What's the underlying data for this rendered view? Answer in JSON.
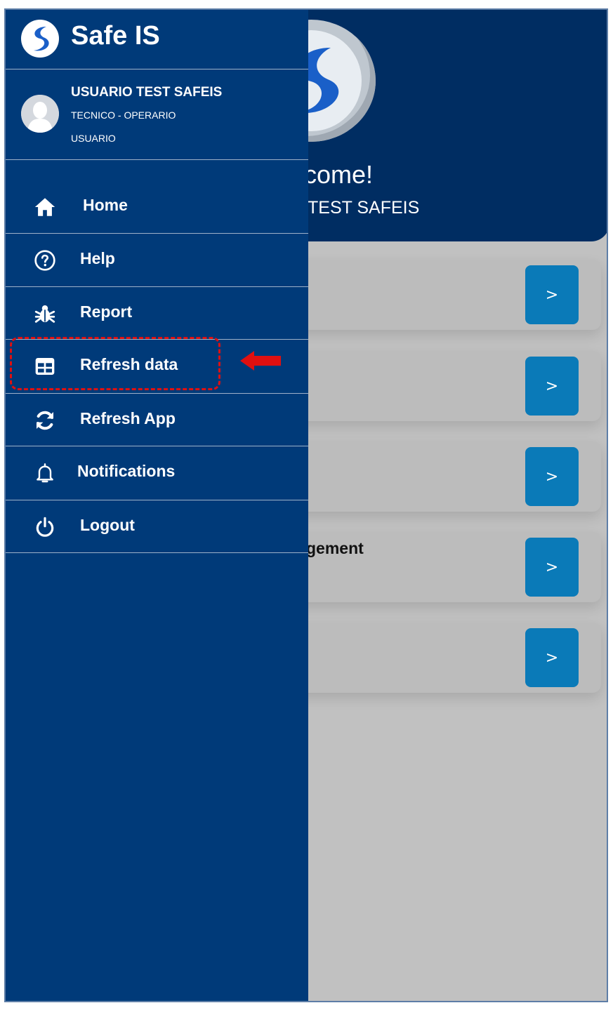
{
  "app": {
    "name": "Safe IS"
  },
  "background": {
    "welcome": "come!",
    "user": "TEST SAFEIS",
    "cards": [
      {
        "label": "",
        "button": ">"
      },
      {
        "label": "",
        "button": ">"
      },
      {
        "label": "",
        "button": ">"
      },
      {
        "label": "gement",
        "button": ">"
      },
      {
        "label": "",
        "button": ">"
      }
    ]
  },
  "drawer": {
    "user": {
      "name": "USUARIO TEST SAFEIS",
      "role": "TECNICO - OPERARIO",
      "type": "USUARIO"
    },
    "menu": [
      {
        "label": "Home",
        "icon": "home-icon"
      },
      {
        "label": "Help",
        "icon": "help-circle-icon"
      },
      {
        "label": "Report",
        "icon": "bug-icon"
      },
      {
        "label": "Refresh data",
        "icon": "table-icon"
      },
      {
        "label": "Refresh App",
        "icon": "refresh-icon"
      },
      {
        "label": "Notifications",
        "icon": "bell-icon"
      },
      {
        "label": "Logout",
        "icon": "power-icon"
      }
    ]
  },
  "colors": {
    "drawer": "#003a79",
    "header": "#002d62",
    "accent": "#0a7ab8",
    "annotation": "#e01010"
  }
}
